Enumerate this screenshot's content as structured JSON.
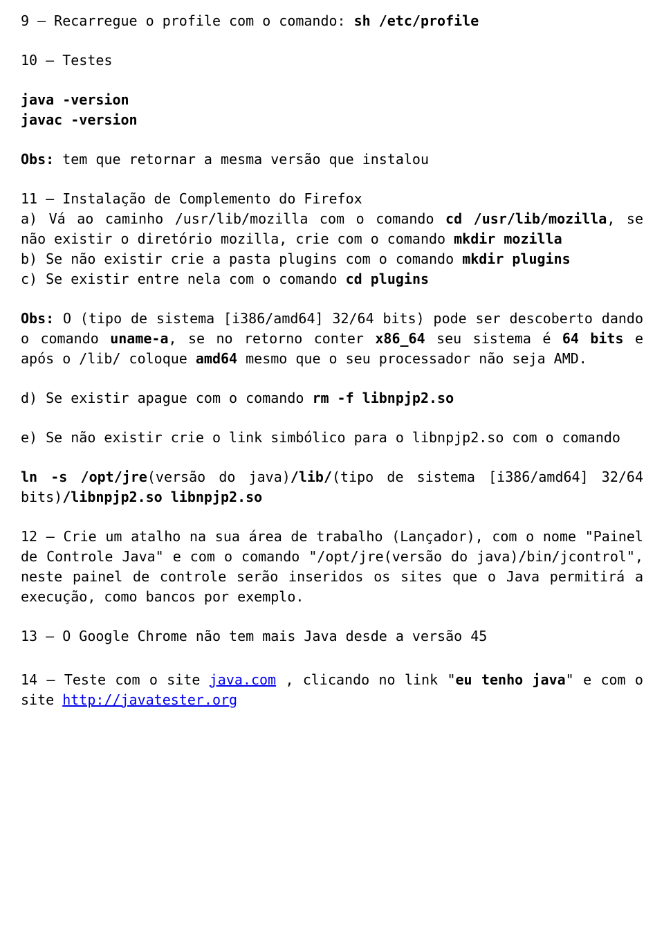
{
  "s9": {
    "a": "9 — Recarregue o profile com o comando: ",
    "b": "sh /etc/profile"
  },
  "s10": "10 — Testes",
  "cmd1": "java -version",
  "cmd2": "javac -version",
  "obs1": {
    "a": "Obs:",
    "b": " tem que retornar a mesma versão que instalou"
  },
  "s11": {
    "title": "11 — Instalação de Complemento do Firefox",
    "a1": "a) Vá ao caminho /usr/lib/mozilla com o comando ",
    "a2": "cd /usr/lib/mozilla",
    "a3": ", se não existir o diretório mozilla, crie com o comando ",
    "a4": "mkdir mozilla",
    "b1": "b) Se não existir crie a pasta plugins com o comando ",
    "b2": "mkdir plugins",
    "c1": "c) Se existir entre nela com o comando ",
    "c2": "cd plugins"
  },
  "obs2": {
    "a": "Obs:",
    "b": " O (tipo de sistema [i386/amd64] 32/64 bits) pode ser descoberto dando o comando ",
    "c": "uname-a",
    "d": ", se no retorno conter ",
    "e": "x86_64",
    "f": " seu sistema é ",
    "g": "64 bits",
    "h": " e após o /lib/ coloque ",
    "i": "amd64",
    "j": " mesmo que o seu processador não seja AMD."
  },
  "d1": "d) Se existir apague com o comando ",
  "d2": "rm -f libnpjp2.so",
  "e1": "e) Se não existir crie o link simbólico para o libnpjp2.so com o comando",
  "ln1": " ln -s /opt/jre",
  "ln2": "(versão do java)",
  "ln3": "/lib/",
  "ln4": "(tipo de sistema [i386/amd64] 32/64 bits)",
  "ln5": "/libnpjp2.so libnpjp2.so",
  "s12": "12 — Crie um atalho na sua área de trabalho (Lançador), com o nome \"Painel de Controle Java\" e com o comando \"/opt/jre(versão do java)/bin/jcontrol\", neste painel de controle serão inseridos os sites que o Java  permitirá a execução, como bancos por exemplo.",
  "s13": "13 — O Google Chrome não tem mais Java desde a versão 45",
  "s14": {
    "a": "14 — Teste com o site ",
    "b": "java.com",
    "c": " , clicando no link \"",
    "d": "eu tenho java",
    "e": "\" e com o site ",
    "f": "http://javatester.org"
  }
}
